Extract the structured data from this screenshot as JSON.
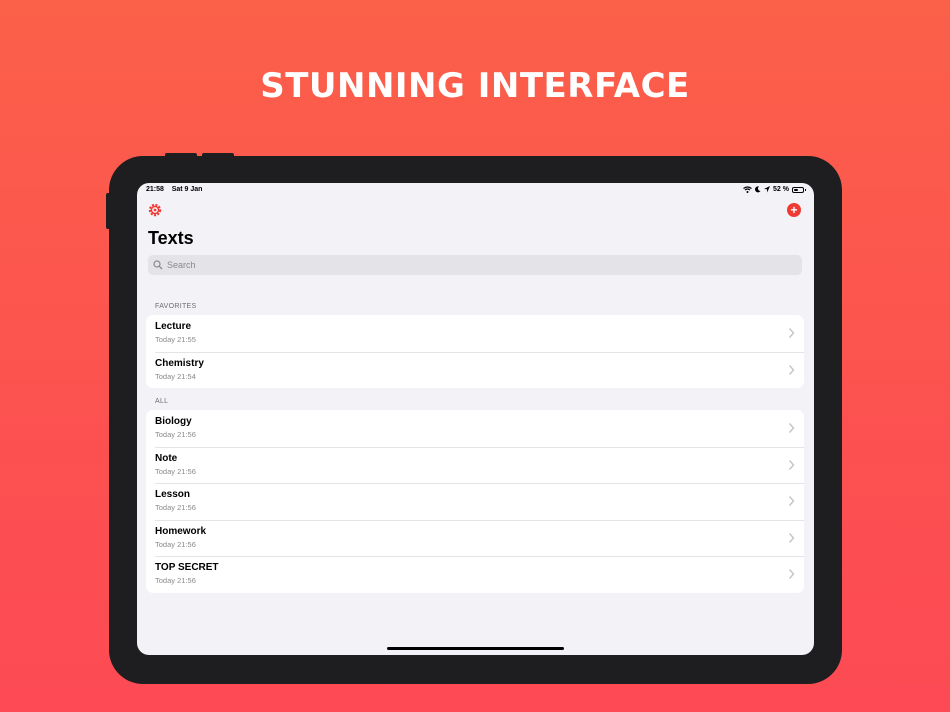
{
  "headline": "STUNNING INTERFACE",
  "status": {
    "time": "21:58",
    "date": "Sat 9 Jan",
    "battery": "52 %",
    "battery_level": 0.52
  },
  "nav": {
    "settings_icon": "gear-icon",
    "add_icon": "plus-circle-icon",
    "add_glyph": "+"
  },
  "page": {
    "title": "Texts",
    "search_placeholder": "Search"
  },
  "favorites": {
    "header": "FAVORITES",
    "items": [
      {
        "title": "Lecture",
        "subtitle": "Today 21:55"
      },
      {
        "title": "Chemistry",
        "subtitle": "Today 21:54"
      }
    ]
  },
  "all": {
    "header": "ALL",
    "items": [
      {
        "title": "Biology",
        "subtitle": "Today 21:56"
      },
      {
        "title": "Note",
        "subtitle": "Today 21:56"
      },
      {
        "title": "Lesson",
        "subtitle": "Today 21:56"
      },
      {
        "title": "Homework",
        "subtitle": "Today 21:56"
      },
      {
        "title": "TOP SECRET",
        "subtitle": "Today 21:56"
      }
    ]
  },
  "colors": {
    "accent": "#f03a34",
    "background_top": "#fb6049",
    "background_bottom": "#fd4a55"
  }
}
